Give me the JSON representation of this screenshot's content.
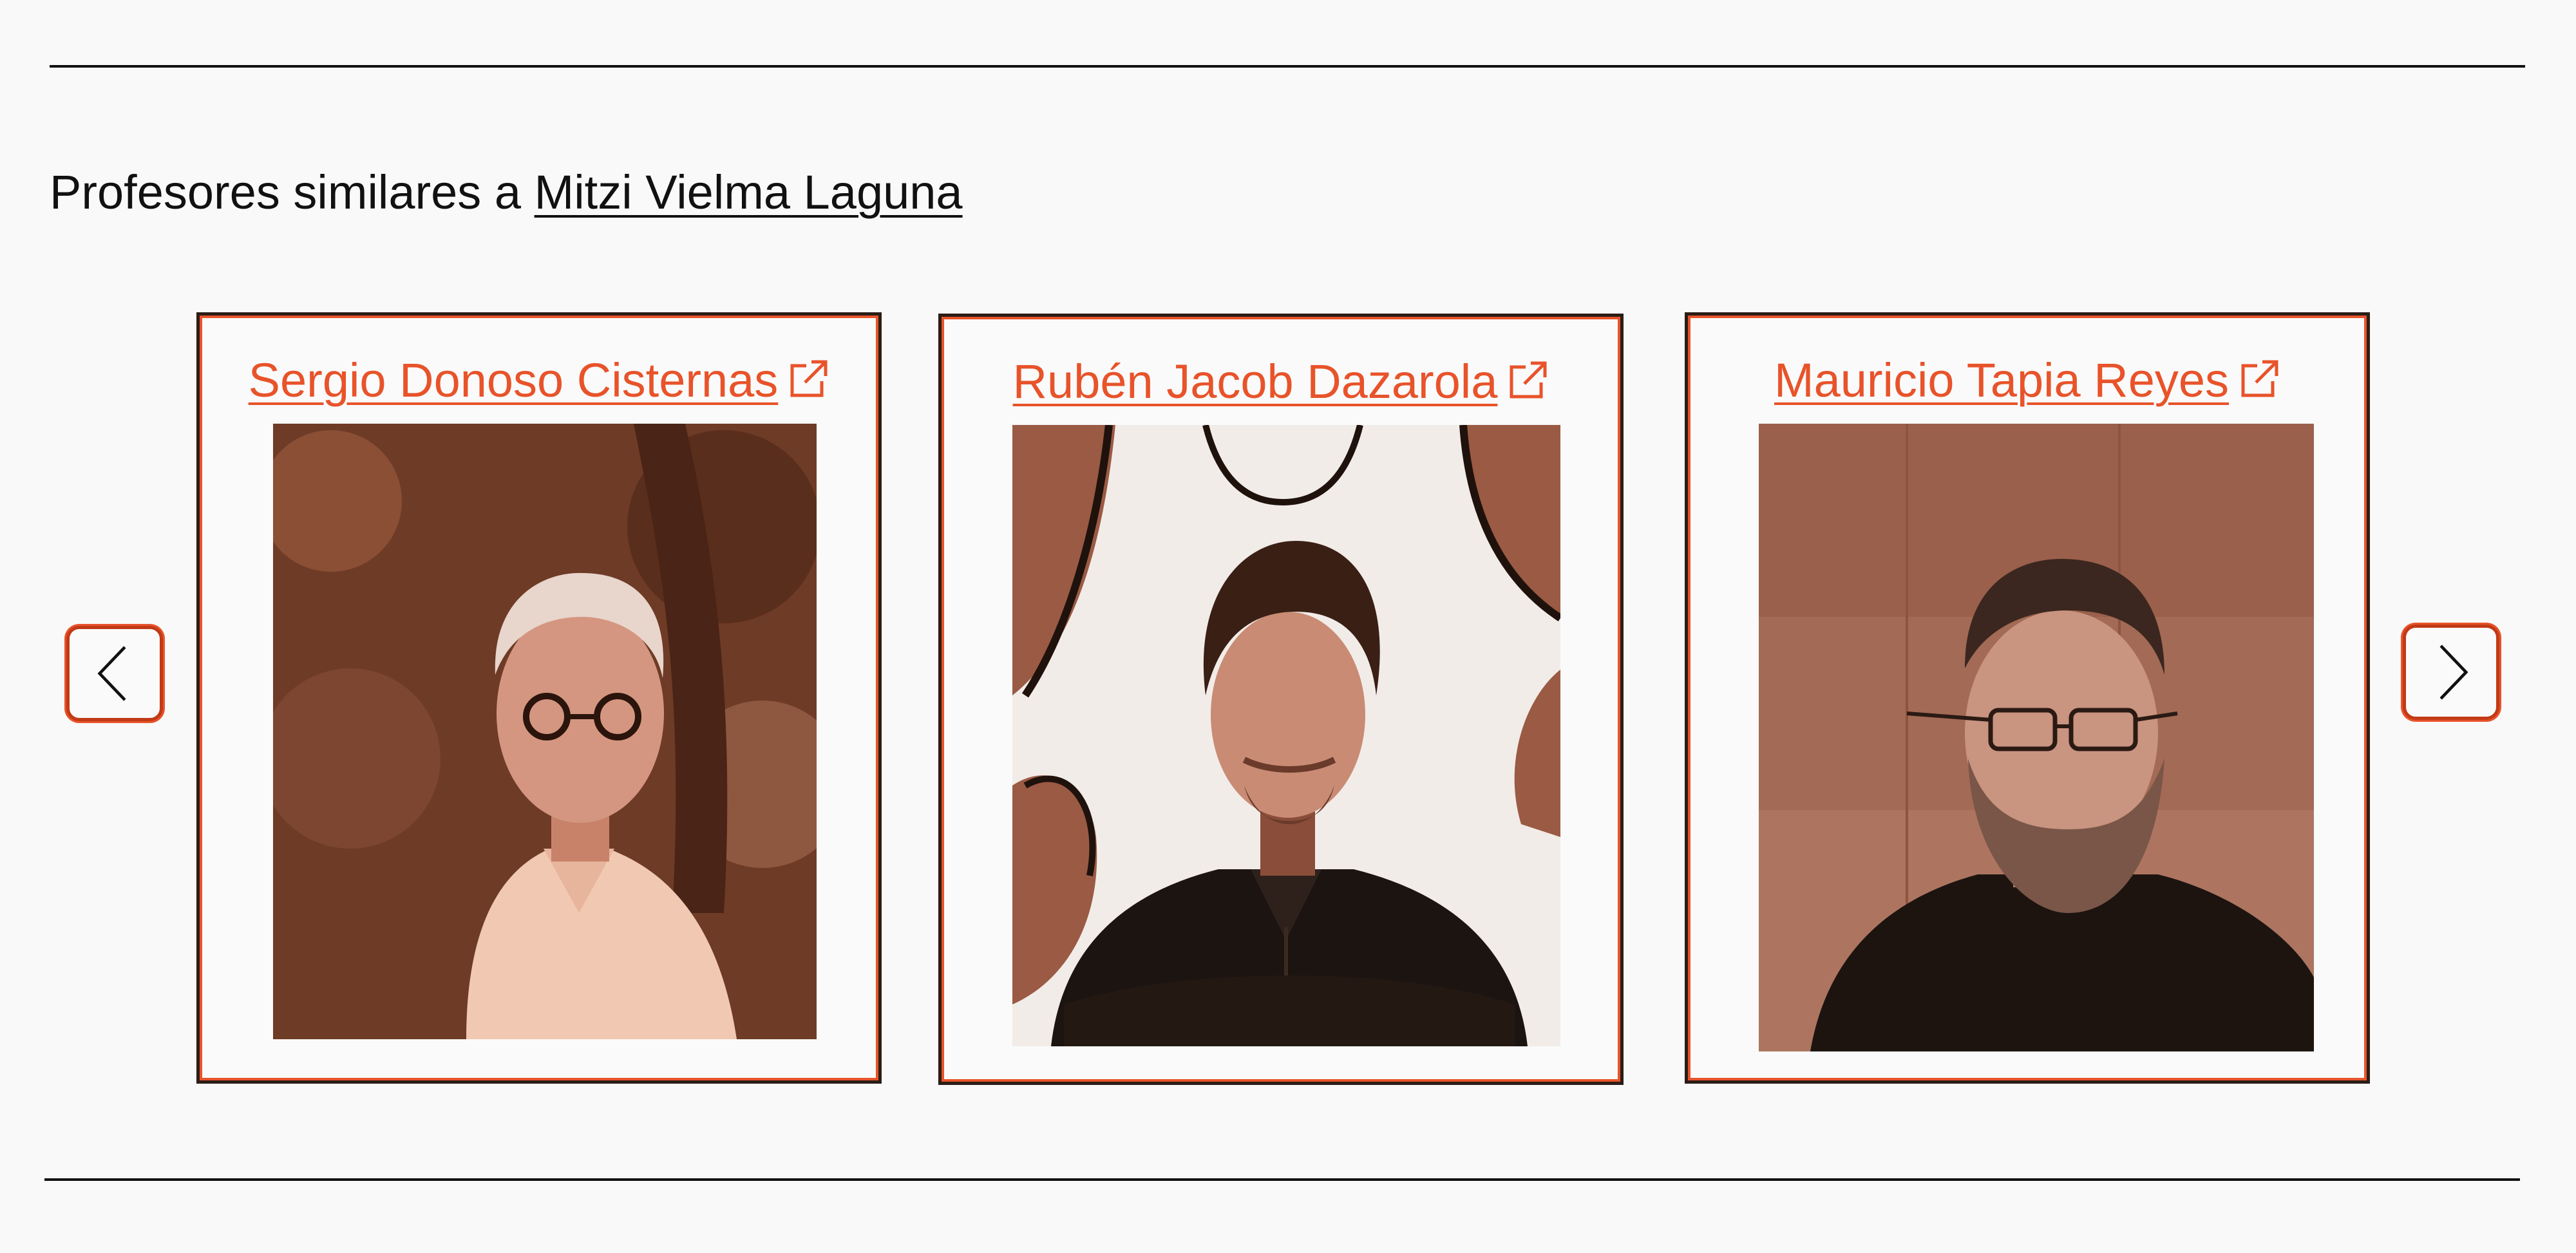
{
  "section": {
    "heading_prefix": "Profesores similares a ",
    "heading_link": "Mitzi Vielma Laguna"
  },
  "carousel": {
    "prev_icon": "chevron-left-icon",
    "next_icon": "chevron-right-icon",
    "accent_color": "#e8532a",
    "cards": [
      {
        "name": "Sergio Donoso Cisternas",
        "icon": "external-link-icon"
      },
      {
        "name": "Rubén Jacob Dazarola",
        "icon": "external-link-icon"
      },
      {
        "name": "Mauricio Tapia Reyes",
        "icon": "external-link-icon"
      }
    ]
  }
}
